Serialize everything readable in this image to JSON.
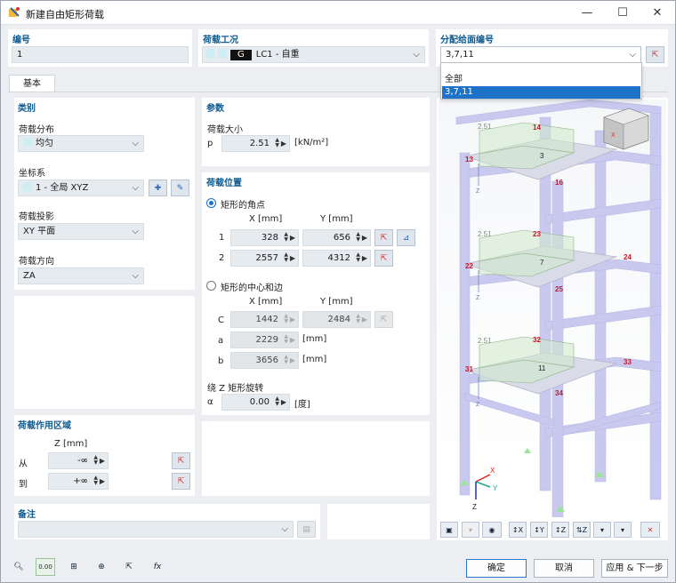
{
  "window": {
    "title": "新建自由矩形荷载",
    "minimize": "—",
    "maximize": "☐",
    "close": "✕"
  },
  "top": {
    "number_label": "编号",
    "number_value": "1",
    "loadcase_label": "荷载工况",
    "loadcase_tag": "G",
    "loadcase_value": "LC1 - 自重",
    "surfaces_label": "分配给面编号",
    "surfaces_value": "3,7,11",
    "dropdown_options": [
      "全部",
      "3,7,11"
    ]
  },
  "tab": "基本",
  "category": {
    "header": "类别",
    "distribution_label": "荷载分布",
    "distribution_value": "均匀",
    "coord_label": "坐标系",
    "coord_value": "1 - 全局 XYZ",
    "projection_label": "荷载投影",
    "projection_value": "XY 平面",
    "direction_label": "荷载方向",
    "direction_value": "ZA"
  },
  "region": {
    "header": "荷载作用区域",
    "z_unit": "Z [mm]",
    "from_label": "从",
    "from_value": "-∞",
    "to_label": "到",
    "to_value": "+∞"
  },
  "params": {
    "header": "参数",
    "magnitude_label": "荷载大小",
    "p_label": "p",
    "p_value": "2.51",
    "p_unit": "[kN/m²]"
  },
  "position": {
    "header": "荷载位置",
    "corners_label": "矩形的角点",
    "x_header": "X [mm]",
    "y_header": "Y [mm]",
    "rows": [
      {
        "label": "1",
        "x": "328",
        "y": "656"
      },
      {
        "label": "2",
        "x": "2557",
        "y": "4312"
      }
    ],
    "center_label": "矩形的中心和边",
    "c_label": "C",
    "c_x": "1442",
    "c_y": "2484",
    "a_label": "a",
    "a_value": "2229",
    "a_unit": "[mm]",
    "b_label": "b",
    "b_value": "3656",
    "b_unit": "[mm]",
    "rotation_label": "绕 Z 矩形旋转",
    "alpha_label": "α",
    "alpha_value": "0.00",
    "alpha_unit": "[度]"
  },
  "comment": {
    "header": "备注",
    "value": ""
  },
  "view": {
    "load_value": "2.51",
    "nodes": [
      "13",
      "14",
      "16",
      "22",
      "23",
      "24",
      "25",
      "31",
      "32",
      "33",
      "34"
    ],
    "surfaces": [
      "3",
      "7",
      "11"
    ],
    "axis_z": "Z",
    "axis_x": "X",
    "axis_y": "Y"
  },
  "buttons": {
    "ok": "确定",
    "cancel": "取消",
    "apply_next": "应用 & 下一步"
  }
}
